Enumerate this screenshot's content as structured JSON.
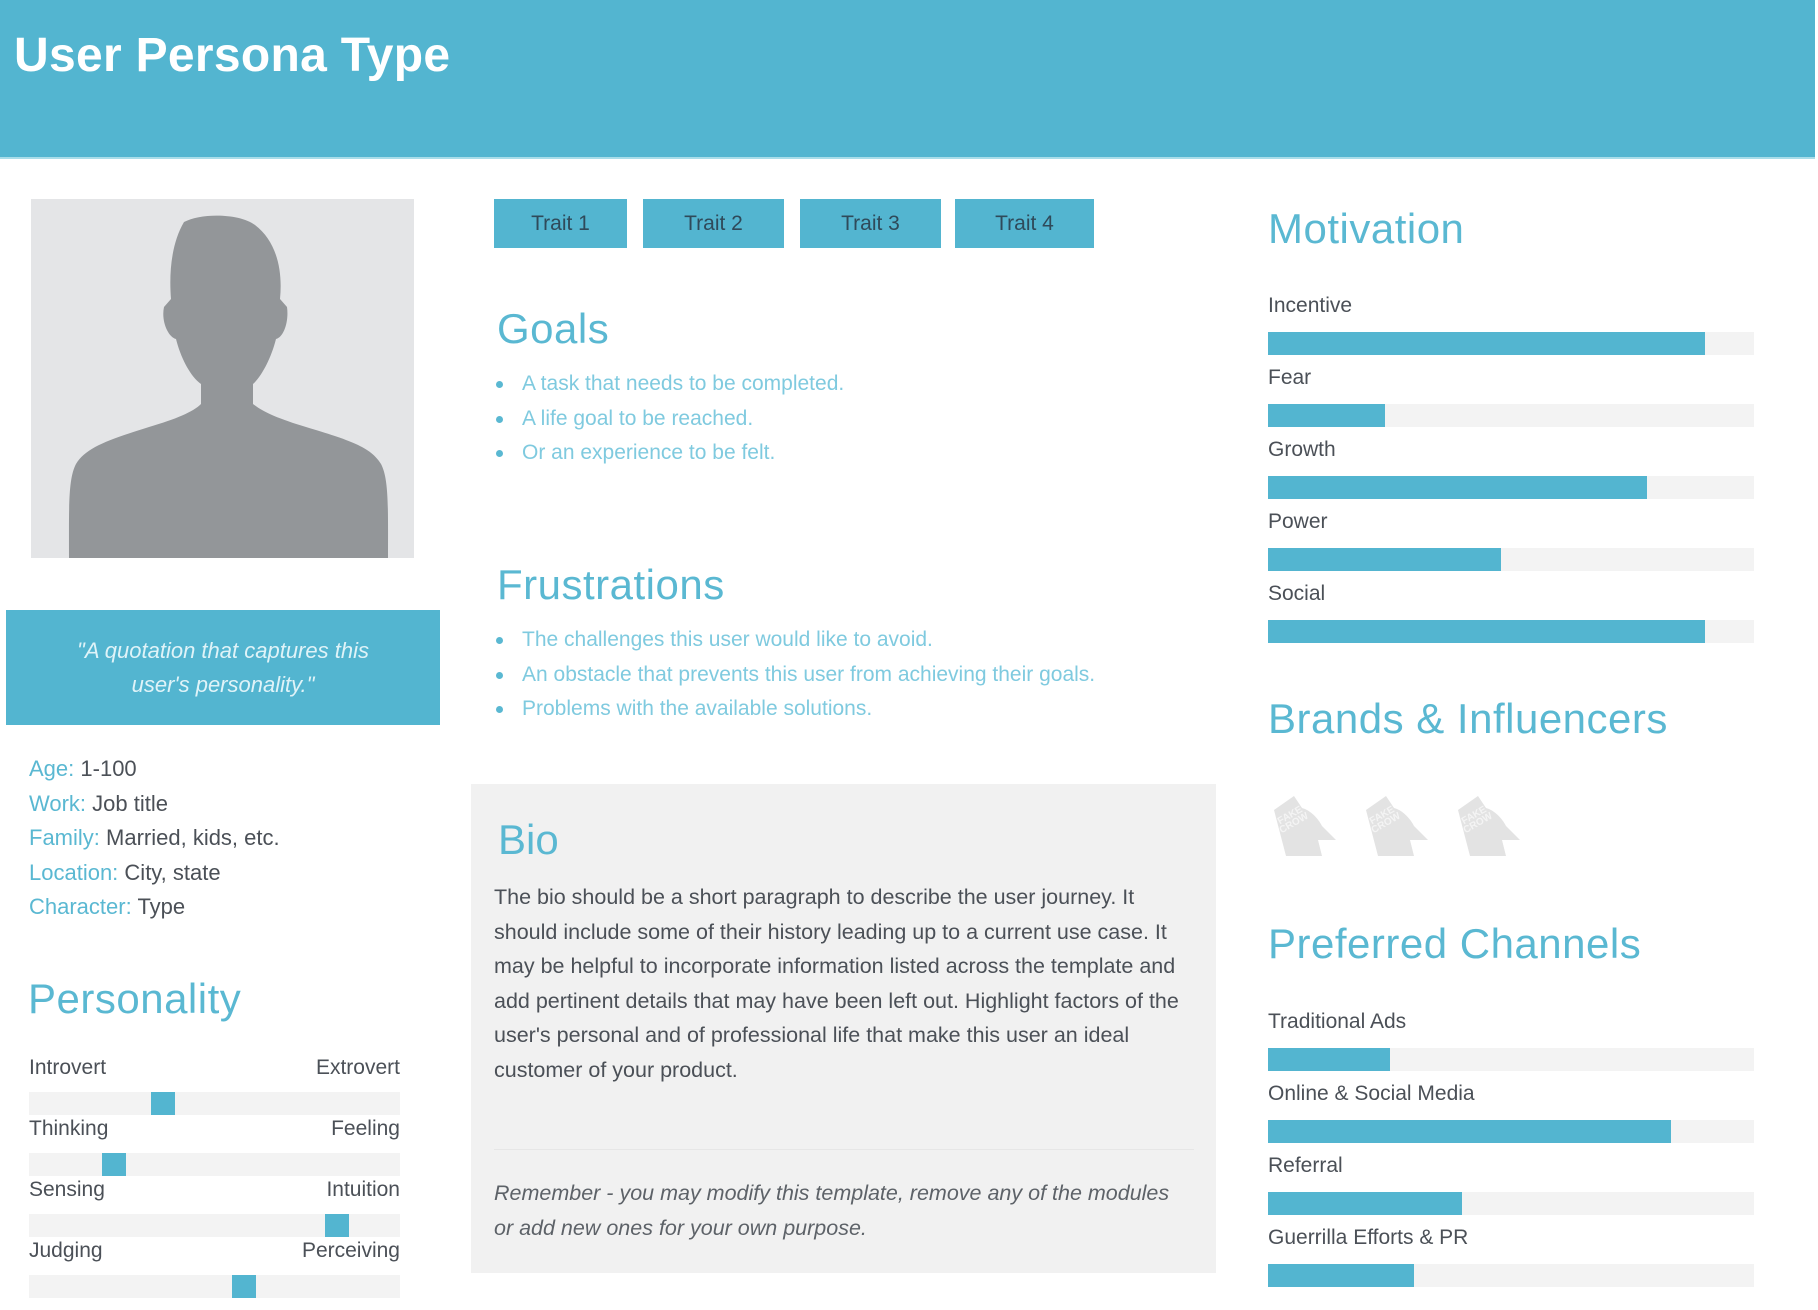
{
  "header": {
    "title": "User Persona Type"
  },
  "profile": {
    "photo_icon": "user-silhouette-icon",
    "quote": "\"A quotation that captures this user's personality.\""
  },
  "demographics": [
    {
      "key": "Age:",
      "value": "1-100"
    },
    {
      "key": "Work:",
      "value": "Job title"
    },
    {
      "key": "Family:",
      "value": "Married, kids, etc."
    },
    {
      "key": "Location:",
      "value": "City, state"
    },
    {
      "key": "Character:",
      "value": "Type"
    }
  ],
  "personality": {
    "title": "Personality",
    "scales": [
      {
        "left": "Introvert",
        "right": "Extrovert",
        "position": 0.36
      },
      {
        "left": "Thinking",
        "right": "Feeling",
        "position": 0.23
      },
      {
        "left": "Sensing",
        "right": "Intuition",
        "position": 0.83
      },
      {
        "left": "Judging",
        "right": "Perceiving",
        "position": 0.58
      }
    ]
  },
  "traits": [
    "Trait 1",
    "Trait 2",
    "Trait 3",
    "Trait 4"
  ],
  "goals": {
    "title": "Goals",
    "items": [
      "A task that needs to be completed.",
      "A life goal to be reached.",
      "Or an experience to be felt."
    ]
  },
  "frustrations": {
    "title": "Frustrations",
    "items": [
      "The challenges this user would like to avoid.",
      "An obstacle that prevents this user from achieving their goals.",
      "Problems with the available solutions."
    ]
  },
  "bio": {
    "title": "Bio",
    "text": "The bio should be a short paragraph to describe the user journey. It should include some of their history leading up to a current use case. It may be helpful to incorporate information listed across the template and add pertinent details that may have been left out. Highlight factors of the user's personal and of professional life that make this user an ideal customer of your product.",
    "note": "Remember - you may modify this template, remove any of the modules or add new ones for your own purpose."
  },
  "motivation": {
    "title": "Motivation",
    "items": [
      {
        "label": "Incentive",
        "value": 0.9
      },
      {
        "label": "Fear",
        "value": 0.24
      },
      {
        "label": "Growth",
        "value": 0.78
      },
      {
        "label": "Power",
        "value": 0.48
      },
      {
        "label": "Social",
        "value": 0.9
      }
    ]
  },
  "brands": {
    "title": "Brands & Influencers",
    "logos": [
      {
        "name": "FAKE CROW",
        "icon": "fake-crow-logo-icon"
      },
      {
        "name": "FAKE CROW",
        "icon": "fake-crow-logo-icon"
      },
      {
        "name": "FAKE CROW",
        "icon": "fake-crow-logo-icon"
      }
    ]
  },
  "channels": {
    "title": "Preferred Channels",
    "items": [
      {
        "label": "Traditional Ads",
        "value": 0.25
      },
      {
        "label": "Online & Social Media",
        "value": 0.83
      },
      {
        "label": "Referral",
        "value": 0.4
      },
      {
        "label": "Guerrilla Efforts & PR",
        "value": 0.3
      }
    ]
  },
  "colors": {
    "accent": "#53b5d0",
    "heading": "#5ab8d2",
    "bullet_text": "#7fcadf",
    "body_text": "#4b5057",
    "track": "#f3f3f3",
    "bio_bg": "#f1f1f1",
    "photo_bg": "#e4e5e7",
    "silhouette": "#939699"
  }
}
